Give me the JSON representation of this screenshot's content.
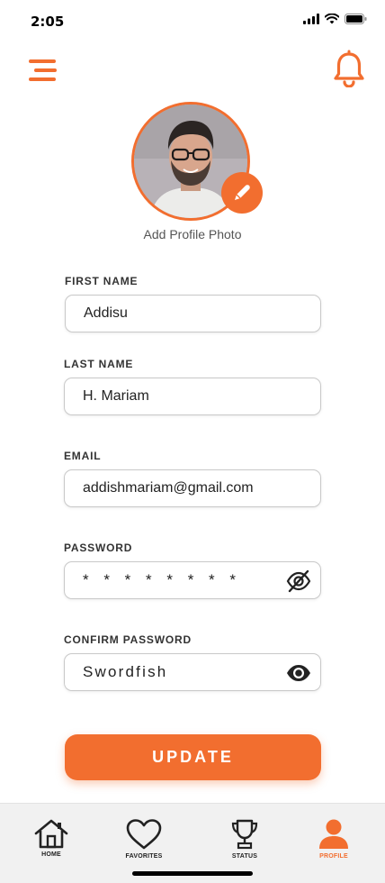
{
  "status_bar": {
    "time": "2:05"
  },
  "header": {
    "menu_icon": "hamburger-icon",
    "notification_icon": "bell-icon"
  },
  "profile": {
    "add_photo_label": "Add Profile Photo",
    "edit_icon": "pencil-icon"
  },
  "form": {
    "first_name": {
      "label": "FIRST NAME",
      "value": "Addisu"
    },
    "last_name": {
      "label": "LAST NAME",
      "value": "H. Mariam"
    },
    "email": {
      "label": "EMAIL",
      "value": "addishmariam@gmail.com"
    },
    "password": {
      "label": "PASSWORD",
      "value": "* * * * * * * *",
      "toggle_icon": "eye-slash-icon"
    },
    "confirm_password": {
      "label": "CONFIRM PASSWORD",
      "value": "Swordfish",
      "toggle_icon": "eye-icon"
    }
  },
  "update_button": {
    "label": "UPDATE"
  },
  "bottom_nav": {
    "items": [
      {
        "label": "HOME",
        "icon": "home-icon"
      },
      {
        "label": "FAVORITES",
        "icon": "heart-icon"
      },
      {
        "label": "STATUS",
        "icon": "trophy-icon"
      },
      {
        "label": "PROFILE",
        "icon": "user-icon"
      }
    ]
  },
  "colors": {
    "accent": "#f26e2f",
    "nav_background": "#f1f1f1"
  }
}
